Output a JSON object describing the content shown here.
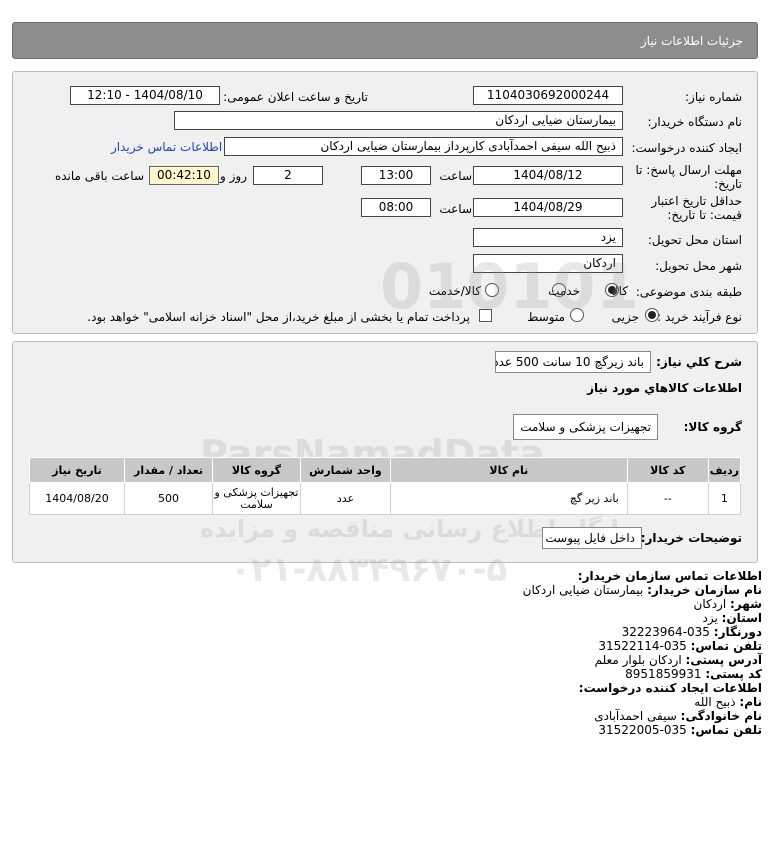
{
  "header": {
    "title": "جزئیات اطلاعات نیاز"
  },
  "info": {
    "need_number_label": "شماره نیاز:",
    "need_number": "1104030692000244",
    "announce_label": "تاریخ و ساعت اعلان عمومی:",
    "announce_value": "1404/08/10 - 12:10",
    "buyer_label": "نام دستگاه خریدار:",
    "buyer_value": "بیمارستان ضیایی اردکان",
    "creator_label": "ایجاد کننده درخواست:",
    "creator_value": "ذبیح الله سیفی احمدآبادی کارپرداز بیمارستان ضیایی اردکان",
    "contact_link": "اطلاعات تماس خریدار",
    "deadline_label": "مهلت ارسال پاسخ: تا تاریخ:",
    "deadline_date": "1404/08/12",
    "time_label": "ساعت",
    "deadline_time": "13:00",
    "days_value": "2",
    "days_label": "روز و",
    "remain_value": "00:42:10",
    "remain_label": "ساعت باقی مانده",
    "validity_label": "حداقل تاریخ اعتبار قیمت: تا تاریخ:",
    "validity_date": "1404/08/29",
    "validity_time": "08:00",
    "province_label": "استان محل تحویل:",
    "province_value": "یزد",
    "city_label": "شهر محل تحویل:",
    "city_value": "اردکان",
    "category_label": "طبقه بندی موضوعی:",
    "category_options": [
      "کالا",
      "خدمت",
      "کالا/خدمت"
    ],
    "category_selected": "کالا",
    "process_label": "نوع فرآیند خرید :",
    "process_options": [
      "جزیی",
      "متوسط"
    ],
    "process_selected": "جزیی",
    "payment_note": "پرداخت تمام یا بخشی از مبلغ خرید،از محل \"اسناد خزانه اسلامی\" خواهد بود."
  },
  "needs": {
    "summary_label": "شرح کلي نياز:",
    "summary_value": "باند زیرگچ 10 سانت 500 عدد",
    "goods_info_label": "اطلاعات کالاهاي مورد نياز",
    "group_label": "گروه کالا:",
    "group_value": "تجهیزات پزشکی و سلامت",
    "table_headers": [
      "ردیف",
      "کد کالا",
      "نام کالا",
      "واحد شمارش",
      "گروه کالا",
      "تعداد / مقدار",
      "تاریخ نیاز"
    ],
    "rows": [
      [
        "1",
        "--",
        "باند زیر گچ",
        "عدد",
        "تجهیزات پزشکی و سلامت",
        "500",
        "1404/08/20"
      ]
    ],
    "buyer_notes_label": "توضیحات خریدار:",
    "buyer_notes_value": "داخل فایل پیوست"
  },
  "contact": {
    "title": "اطلاعات تماس سازمان خریدار:",
    "org_name_label": "نام سازمان خریدار:",
    "org_name_value": "بیمارستان ضیایی اردکان",
    "city_label": "شهر:",
    "city_value": "اردکان",
    "province_label": "استان:",
    "province_value": "یزد",
    "fax_label": "دورنگار:",
    "fax_value": "035-32223964",
    "phone_label": "تلفن تماس:",
    "phone_value": "035-31522114",
    "address_label": "آدرس پستی:",
    "address_value": "اردکان بلوار معلم",
    "postal_label": "کد پستی:",
    "postal_value": "8951859931",
    "creator_title": "اطلاعات ایجاد کننده درخواست:",
    "first_name_label": "نام:",
    "first_name_value": "ذبیح الله",
    "last_name_label": "نام خانوادگی:",
    "last_name_value": "سیفی احمدآبادی",
    "creator_phone_label": "تلفن تماس:",
    "creator_phone_value": "035-31522005"
  },
  "watermark": {
    "brand": "ParsNamadData",
    "tagline": "مرکز فراوری اطلاعات پارس نماد داده",
    "subline": "پایگاه اطلاع رسانی مناقصه و مزایده",
    "phone": "۰۲۱-۸۸۳۴۹۶۷۰-۵",
    "digits": "010101"
  }
}
